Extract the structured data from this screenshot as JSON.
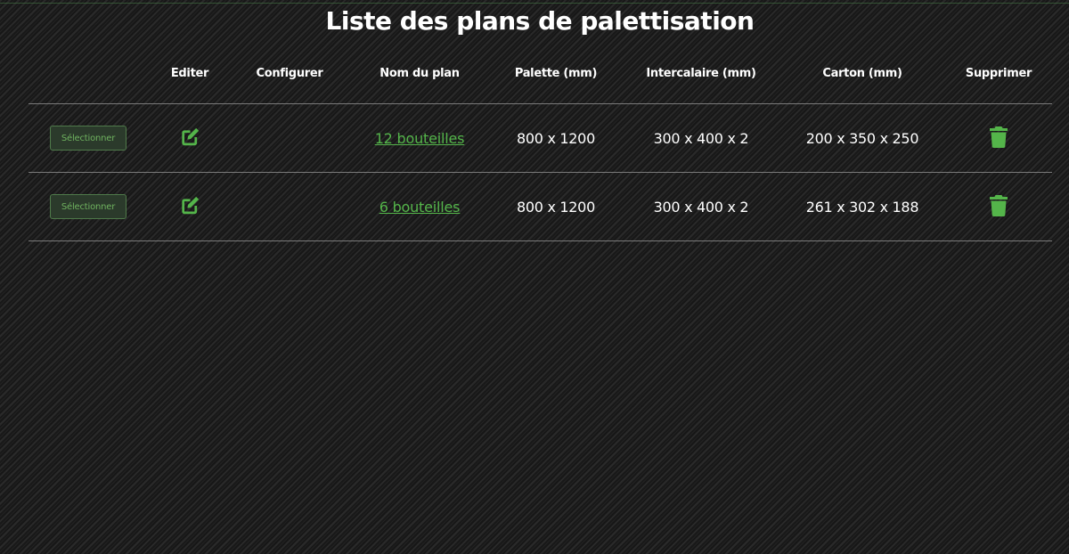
{
  "page": {
    "title": "Liste des plans de palettisation"
  },
  "table": {
    "headers": {
      "edit": "Editer",
      "configure": "Configurer",
      "plan_name": "Nom du plan",
      "palette": "Palette (mm)",
      "intercalaire": "Intercalaire (mm)",
      "carton": "Carton (mm)",
      "delete": "Supprimer"
    },
    "rows": [
      {
        "select_label": "Sélectionner",
        "plan_name": "12 bouteilles",
        "palette": "800 x 1200",
        "intercalaire": "300 x 400 x 2",
        "carton": "200 x 350 x 250"
      },
      {
        "select_label": "Sélectionner",
        "plan_name": "6 bouteilles",
        "palette": "800 x 1200",
        "intercalaire": "300 x 400 x 2",
        "carton": "261 x 302 x 188"
      }
    ]
  },
  "icons": {
    "edit": "edit-icon",
    "delete": "trash-icon"
  },
  "colors": {
    "accent": "#54b54a",
    "text": "#ffffff",
    "divider": "#7a7a7a",
    "button_bg": "#2b3a2b",
    "button_border": "#4f7a4a"
  }
}
